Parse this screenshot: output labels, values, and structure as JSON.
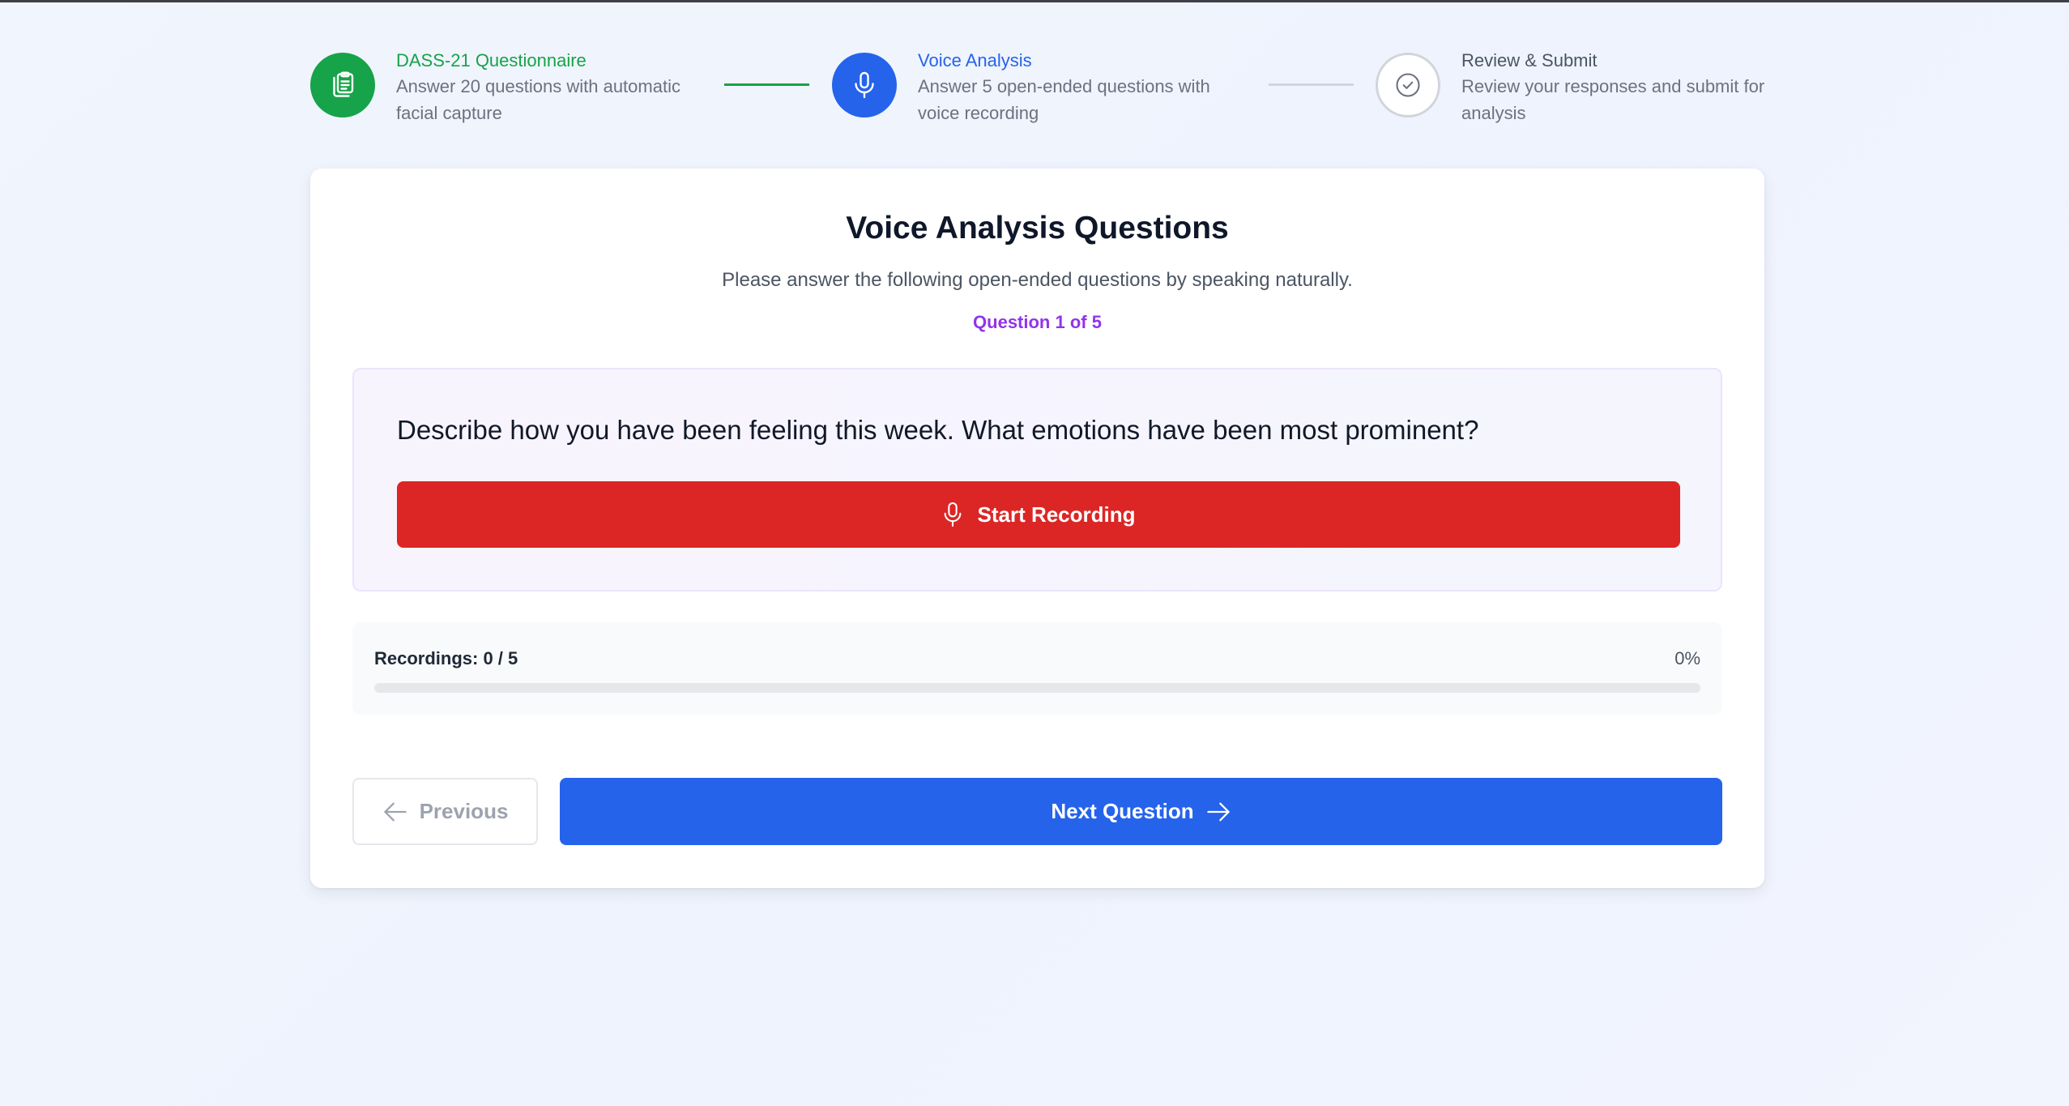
{
  "colors": {
    "completed": "#16a34a",
    "active": "#2563eb",
    "pending": "#d1d5db",
    "record": "#dc2626",
    "accent_purple": "#9333ea"
  },
  "stepper": {
    "steps": [
      {
        "title": "DASS-21 Questionnaire",
        "description": "Answer 20 questions with automatic facial capture",
        "icon": "clipboard-icon",
        "state": "completed"
      },
      {
        "title": "Voice Analysis",
        "description": "Answer 5 open-ended questions with voice recording",
        "icon": "microphone-icon",
        "state": "active"
      },
      {
        "title": "Review & Submit",
        "description": "Review your responses and submit for analysis",
        "icon": "check-circle-icon",
        "state": "pending"
      }
    ]
  },
  "card": {
    "title": "Voice Analysis Questions",
    "subtitle": "Please answer the following open-ended questions by speaking naturally.",
    "counter": "Question 1 of 5"
  },
  "question": {
    "text": "Describe how you have been feeling this week. What emotions have been most prominent?",
    "record_label": "Start Recording",
    "record_icon": "microphone-icon"
  },
  "progress": {
    "label": "Recordings: 0 / 5",
    "percent_text": "0%",
    "fraction": 0
  },
  "nav": {
    "previous_label": "Previous",
    "previous_icon": "arrow-left-icon",
    "next_label": "Next Question",
    "next_icon": "arrow-right-icon"
  }
}
